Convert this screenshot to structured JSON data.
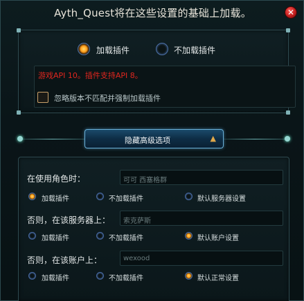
{
  "window": {
    "title": "Ayth_Quest将在这些设置的基础上加载。",
    "close_symbol": "✕"
  },
  "load_mode": {
    "options": [
      "加载插件",
      "不加载插件"
    ],
    "selected": "加载插件"
  },
  "version_error": "游戏API 10。插件支持API 8。",
  "force_load_checkbox": {
    "label": "忽略版本不匹配并强制加载插件",
    "checked": false
  },
  "advanced_toggle": {
    "label": "隐藏高级选项",
    "arrow": "▲"
  },
  "sections": [
    {
      "label": "在使用角色时：",
      "value": "可可 西塞格群",
      "options": [
        "加载插件",
        "不加载插件",
        "默认服务器设置"
      ],
      "selected": "加载插件"
    },
    {
      "label": "否则，在该服务器上：",
      "value": "索克萨斯",
      "options": [
        "加载插件",
        "不加载插件",
        "默认账户设置"
      ],
      "selected": "默认账户设置"
    },
    {
      "label": "否则，在该账户上：",
      "value": "wexood",
      "options": [
        "加载插件",
        "不加载插件",
        "默认正常设置"
      ],
      "selected": "默认正常设置"
    }
  ],
  "colors": {
    "error_text": "#e0261f",
    "radio_selected": "#ff9d1a",
    "accent": "#6ab0d8",
    "close_button": "#c21d1d"
  }
}
